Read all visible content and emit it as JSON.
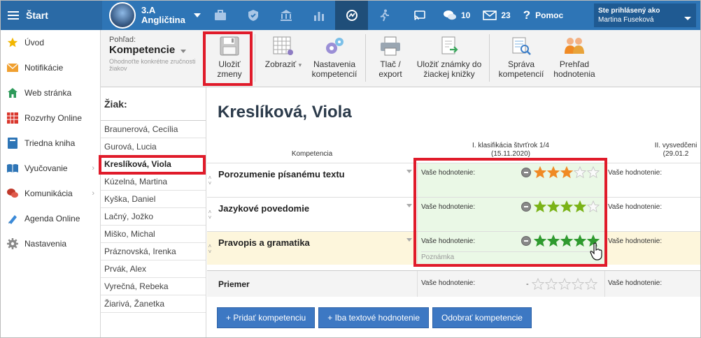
{
  "topbar": {
    "start_label": "Štart",
    "class_name": "3.A",
    "class_subject": "Angličtina",
    "messages_count": "10",
    "mail_count": "23",
    "help_label": "Pomoc",
    "user_label": "Ste prihlásený ako",
    "user_name": "Martina Fuseková"
  },
  "sidebar": {
    "items": [
      {
        "label": "Úvod",
        "icon": "star-icon"
      },
      {
        "label": "Notifikácie",
        "icon": "envelope-icon"
      },
      {
        "label": "Web stránka",
        "icon": "home-icon"
      },
      {
        "label": "Rozvrhy Online",
        "icon": "timetable-icon"
      },
      {
        "label": "Triedna kniha",
        "icon": "book-icon"
      },
      {
        "label": "Vyučovanie",
        "icon": "open-book-icon"
      },
      {
        "label": "Komunikácia",
        "icon": "chat-icon"
      },
      {
        "label": "Agenda Online",
        "icon": "pencil-icon"
      },
      {
        "label": "Nastavenia",
        "icon": "gear-icon"
      }
    ]
  },
  "toolbar": {
    "view_label": "Pohľad:",
    "view_title": "Kompetencie",
    "view_desc": "Ohodnoťte konkrétne zručnosti žiakov",
    "save_line1": "Uložiť",
    "save_line2": "zmeny",
    "show_label": "Zobraziť",
    "settings_line1": "Nastavenia",
    "settings_line2": "kompetencií",
    "print_line1": "Tlač /",
    "print_line2": "export",
    "save_grades_line1": "Uložiť známky do",
    "save_grades_line2": "žiackej knižky",
    "manage_line1": "Správa",
    "manage_line2": "kompetencií",
    "overview_line1": "Prehľad",
    "overview_line2": "hodnotenia"
  },
  "students": {
    "title": "Žiak:",
    "list": [
      "Braunerová, Cecília",
      "Gurová, Lucia",
      "Kreslíková, Viola",
      "Kúzelná, Martina",
      "Kyška, Daniel",
      "Lačný, Jožko",
      "Miško, Michal",
      "Práznovská, Irenka",
      "Prvák, Alex",
      "Vyrečná, Rebeka",
      "Žiarivá, Žanetka"
    ],
    "selected_index": 2
  },
  "main": {
    "student_name": "Kreslíková, Viola",
    "col_competence": "Kompetencia",
    "period1_title": "I. klasifikácia štvrťrok 1/4",
    "period1_date": "(15.11.2020)",
    "period2_title": "II. vysvedčeni",
    "period2_date": "(29.01.2",
    "rating_label": "Vaše hodnotenie:",
    "note_placeholder": "Poznámka",
    "rows": [
      {
        "name": "Porozumenie písanému textu",
        "stars": 3,
        "color": "#f08a24"
      },
      {
        "name": "Jazykové povedomie",
        "stars": 4,
        "color": "#7ab317"
      },
      {
        "name": "Pravopis a gramatika",
        "stars": 5,
        "color": "#2f9a2f"
      }
    ],
    "average_label": "Priemer",
    "average_value": "-"
  },
  "buttons": {
    "add_competence": "+ Pridať kompetenciu",
    "add_text_only": "+ Iba textové hodnotenie",
    "remove_competence": "Odobrať kompetencie"
  }
}
